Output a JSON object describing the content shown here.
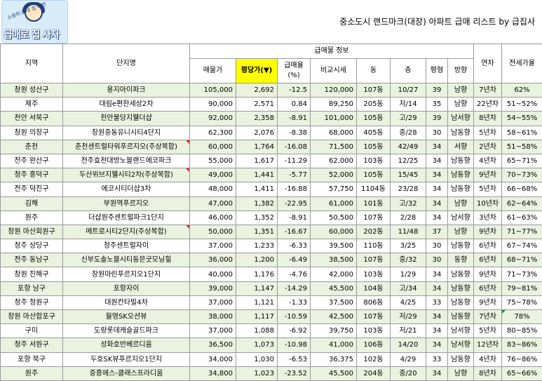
{
  "logo": {
    "tagline": "소중하고 내 집 마련",
    "name": "급매로 집 사자"
  },
  "title": "중소도시 랜드마크(대장) 아파트 급매 리스트 by 급집사",
  "headers": {
    "region": "지역",
    "complex": "단지명",
    "group": "급매물 정보",
    "price": "매물가",
    "per_pyeong": "평당가(▼)",
    "drop": "급매율 (%)",
    "compare": "비교시세",
    "dong": "동",
    "floor": "층",
    "pyeong": "평형",
    "direction": "방향",
    "year": "연차",
    "jeonse": "전세가율"
  },
  "rows": [
    {
      "region": "창원 성산구",
      "complex": "용지아이파크",
      "price": "105,000",
      "per_pyeong": "2,692",
      "drop": "-12.5",
      "compare": "120,000",
      "dong": "107동",
      "floor": "10/27",
      "pyeong": "39",
      "direction": "남향",
      "year": "7년차",
      "jeonse": "62%"
    },
    {
      "region": "제주",
      "complex": "대림e편한세상2차",
      "price": "90,000",
      "per_pyeong": "2,571",
      "drop": "0.84",
      "compare": "89,250",
      "dong": "205동",
      "floor": "저/14",
      "pyeong": "35",
      "direction": "남향",
      "year": "22년차",
      "jeonse": "51~52%"
    },
    {
      "region": "천안 서북구",
      "complex": "천안불당지웰더샵",
      "price": "92,000",
      "per_pyeong": "2,358",
      "drop": "-8.91",
      "compare": "101,000",
      "dong": "105동",
      "floor": "고/29",
      "pyeong": "39",
      "direction": "남서향",
      "year": "8년차",
      "jeonse": "54~55%"
    },
    {
      "region": "창원 의창구",
      "complex": "창원중동유니시티4단지",
      "price": "62,300",
      "per_pyeong": "2,076",
      "drop": "-8.38",
      "compare": "68,000",
      "dong": "405동",
      "floor": "중/28",
      "pyeong": "30",
      "direction": "남동향",
      "year": "5년차",
      "jeonse": "58~61%"
    },
    {
      "region": "춘천",
      "complex": "춘천센트럴타워푸르지오(주상복합)",
      "price": "60,000",
      "per_pyeong": "1,764",
      "drop": "-16.08",
      "compare": "71,500",
      "dong": "105동",
      "floor": "42/49",
      "pyeong": "34",
      "direction": "서향",
      "year": "2년차",
      "jeonse": "51~58%"
    },
    {
      "region": "전주 완산구",
      "complex": "전주효천대방노블랜드에코파크",
      "price": "55,000",
      "per_pyeong": "1,617",
      "drop": "-11.29",
      "compare": "62,000",
      "dong": "103동",
      "floor": "12/25",
      "pyeong": "34",
      "direction": "남동향",
      "year": "4년차",
      "jeonse": "65~71%"
    },
    {
      "region": "청주 흥덕구",
      "complex": "두산위브지웰시티2차(주상복합)",
      "price": "49,000",
      "per_pyeong": "1,441",
      "drop": "-5.77",
      "compare": "52,000",
      "dong": "105동",
      "floor": "15/45",
      "pyeong": "34",
      "direction": "남동향",
      "year": "9년차",
      "jeonse": "70~73%"
    },
    {
      "region": "전주 덕진구",
      "complex": "에코시티더샵3차",
      "price": "48,000",
      "per_pyeong": "1,411",
      "drop": "-16.88",
      "compare": "57,750",
      "dong": "1104동",
      "floor": "23/28",
      "pyeong": "34",
      "direction": "남동향",
      "year": "5년차",
      "jeonse": "66~68%"
    },
    {
      "region": "김해",
      "complex": "부원역푸르지오",
      "price": "47,000",
      "per_pyeong": "1,382",
      "drop": "-22.95",
      "compare": "61,000",
      "dong": "101동",
      "floor": "고/32",
      "pyeong": "34",
      "direction": "남향",
      "year": "10년차",
      "jeonse": "62~64%"
    },
    {
      "region": "원주",
      "complex": "더샵원주센트럴파크1단지",
      "price": "46,000",
      "per_pyeong": "1,352",
      "drop": "-8.91",
      "compare": "50,500",
      "dong": "107동",
      "floor": "2/28",
      "pyeong": "34",
      "direction": "남서향",
      "year": "3년차",
      "jeonse": "61~63%"
    },
    {
      "region": "창원 마산회원구",
      "complex": "메트로시티2단지(주상복합)",
      "price": "50,000",
      "per_pyeong": "1,351",
      "drop": "-16.67",
      "compare": "60,000",
      "dong": "202동",
      "floor": "11/48",
      "pyeong": "37",
      "direction": "남향",
      "year": "9년차",
      "jeonse": "71~77%"
    },
    {
      "region": "청주 상당구",
      "complex": "청주센트럴자이",
      "price": "37,000",
      "per_pyeong": "1,233",
      "drop": "-6.33",
      "compare": "39,500",
      "dong": "110동",
      "floor": "3/25",
      "pyeong": "30",
      "direction": "남동향",
      "year": "6년차",
      "jeonse": "67~74%"
    },
    {
      "region": "전주 동남구",
      "complex": "신부도솔노블시티동문굿모닝힐",
      "price": "36,000",
      "per_pyeong": "1,200",
      "drop": "-6.49",
      "compare": "38,500",
      "dong": "107동",
      "floor": "중/32",
      "pyeong": "30",
      "direction": "동향",
      "year": "6년차",
      "jeonse": "68~71%"
    },
    {
      "region": "창원 진해구",
      "complex": "창원마린푸르지오1단지",
      "price": "40,000",
      "per_pyeong": "1,176",
      "drop": "-4.76",
      "compare": "42,000",
      "dong": "103동",
      "floor": "1/29",
      "pyeong": "34",
      "direction": "남동향",
      "year": "9년차",
      "jeonse": "71~73%"
    },
    {
      "region": "포항 남구",
      "complex": "포항자이",
      "price": "39,000",
      "per_pyeong": "1,147",
      "drop": "-14.29",
      "compare": "45,500",
      "dong": "104동",
      "floor": "고/34",
      "pyeong": "34",
      "direction": "남동향",
      "year": "6년차",
      "jeonse": "79~81%"
    },
    {
      "region": "청주 청원구",
      "complex": "대원칸타빌4차",
      "price": "37,000",
      "per_pyeong": "1,121",
      "drop": "-1.33",
      "compare": "37,500",
      "dong": "806동",
      "floor": "4/25",
      "pyeong": "33",
      "direction": "남동향",
      "year": "9년차",
      "jeonse": "75~78%"
    },
    {
      "region": "창원 마산합포구",
      "complex": "월영SK오션뷰",
      "price": "38,000",
      "per_pyeong": "1,117",
      "drop": "-10.59",
      "compare": "42,500",
      "dong": "107동",
      "floor": "저/29",
      "pyeong": "34",
      "direction": "남동향",
      "year": "7년차",
      "jeonse": "78%"
    },
    {
      "region": "구미",
      "complex": "도량롯데캐슬골드파크",
      "price": "37,000",
      "per_pyeong": "1,088",
      "drop": "-6.92",
      "compare": "39,750",
      "dong": "103동",
      "floor": "저/21",
      "pyeong": "34",
      "direction": "남서향",
      "year": "5년차",
      "jeonse": "80~85%"
    },
    {
      "region": "청주 서원구",
      "complex": "성화호반베르디움",
      "price": "36,500",
      "per_pyeong": "1,073",
      "drop": "-10.98",
      "compare": "41,000",
      "dong": "106동",
      "floor": "14/20",
      "pyeong": "34",
      "direction": "남서향",
      "year": "12년차",
      "jeonse": "83~86%"
    },
    {
      "region": "포항 북구",
      "complex": "두호SK뷰푸르지오1단지",
      "price": "34,000",
      "per_pyeong": "1,030",
      "drop": "-6.53",
      "compare": "36,375",
      "dong": "102동",
      "floor": "4/29",
      "pyeong": "33",
      "direction": "남동향",
      "year": "4년차",
      "jeonse": "76~86%"
    },
    {
      "region": "원주",
      "complex": "중흥에스-클래스프라디움",
      "price": "34,800",
      "per_pyeong": "1,023",
      "drop": "-23.52",
      "compare": "45,500",
      "dong": "204동",
      "floor": "중/20",
      "pyeong": "34",
      "direction": "남향",
      "year": "8년차",
      "jeonse": "65~66%"
    }
  ]
}
